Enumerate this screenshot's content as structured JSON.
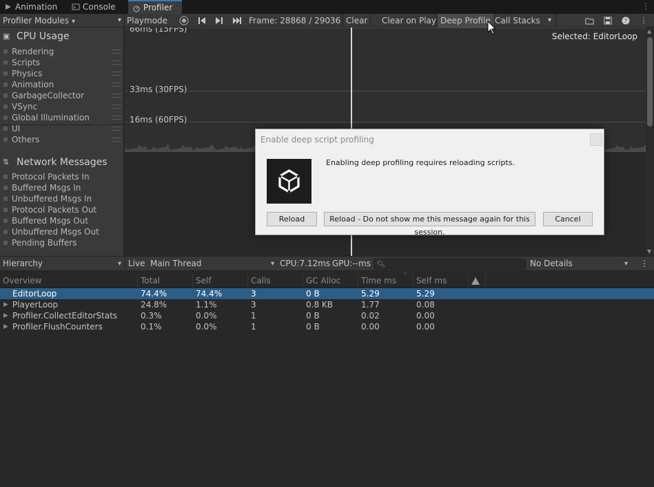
{
  "tabs": [
    {
      "label": "Animation",
      "icon": "animation-icon"
    },
    {
      "label": "Console",
      "icon": "console-icon"
    },
    {
      "label": "Profiler",
      "icon": "profiler-icon",
      "active": true
    }
  ],
  "toolbar": {
    "modules_label": "Profiler Modules",
    "playmode_label": "Playmode",
    "frame_label": "Frame: 28868 / 29036",
    "clear_label": "Clear",
    "clear_on_play_label": "Clear on Play",
    "deep_profile_label": "Deep Profile",
    "call_stacks_label": "Call Stacks"
  },
  "modules": {
    "cpu": {
      "title": "CPU Usage",
      "items": [
        "Rendering",
        "Scripts",
        "Physics",
        "Animation",
        "GarbageCollector",
        "VSync",
        "Global Illumination",
        "UI",
        "Others"
      ]
    },
    "network": {
      "title": "Network Messages",
      "items": [
        "Protocol Packets In",
        "Buffered Msgs In",
        "Unbuffered Msgs In",
        "Protocol Packets Out",
        "Buffered Msgs Out",
        "Unbuffered Msgs Out",
        "Pending Buffers"
      ]
    }
  },
  "chart": {
    "top_label": "66ms (15FPS)",
    "mid_label": "33ms (30FPS)",
    "low_label": "16ms (60FPS)",
    "selected": "Selected: EditorLoop"
  },
  "hierarchy_bar": {
    "view": "Hierarchy",
    "live": "Live",
    "thread": "Main Thread",
    "cpu": "CPU:7.12ms",
    "gpu": "GPU:--ms",
    "details": "No Details"
  },
  "table": {
    "columns": [
      "Overview",
      "Total",
      "Self",
      "Calls",
      "GC Alloc",
      "Time ms",
      "Self ms"
    ],
    "rows": [
      {
        "name": "EditorLoop",
        "total": "74.4%",
        "self": "74.4%",
        "calls": "3",
        "gc": "0 B",
        "time": "5.29",
        "selfms": "5.29"
      },
      {
        "name": "PlayerLoop",
        "total": "24.8%",
        "self": "1.1%",
        "calls": "3",
        "gc": "0.8 KB",
        "time": "1.77",
        "selfms": "0.08"
      },
      {
        "name": "Profiler.CollectEditorStats",
        "total": "0.3%",
        "self": "0.0%",
        "calls": "1",
        "gc": "0 B",
        "time": "0.02",
        "selfms": "0.00"
      },
      {
        "name": "Profiler.FlushCounters",
        "total": "0.1%",
        "self": "0.0%",
        "calls": "1",
        "gc": "0 B",
        "time": "0.00",
        "selfms": "0.00"
      }
    ]
  },
  "dialog": {
    "title": "Enable deep script profiling",
    "message": "Enabling deep profiling requires reloading scripts.",
    "reload_label": "Reload",
    "reload_dont_show_label": "Reload - Do not show me this message again for this session.",
    "cancel_label": "Cancel"
  },
  "colors": {
    "accent": "#3a79bb",
    "selection": "#2c5d87",
    "dialog_bg": "#f0f0f0"
  }
}
